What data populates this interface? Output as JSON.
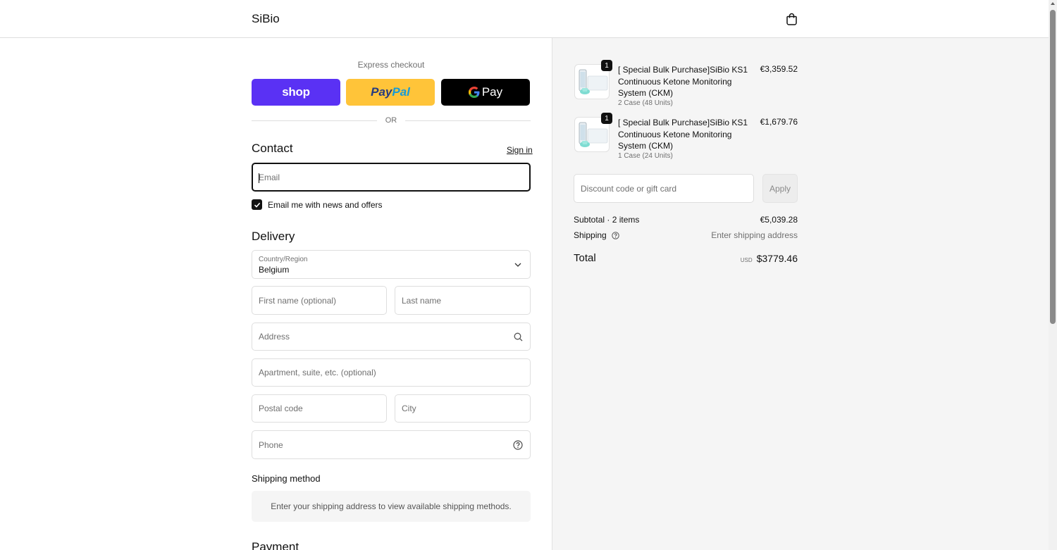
{
  "header": {
    "brand": "SiBio"
  },
  "express": {
    "label": "Express checkout",
    "shop_label": "shop",
    "paypal_label_1": "Pay",
    "paypal_label_2": "Pal",
    "gpay_label": "Pay",
    "or_label": "OR"
  },
  "contact": {
    "title": "Contact",
    "signin_label": "Sign in",
    "email_placeholder": "Email",
    "newsletter_label": "Email me with news and offers",
    "newsletter_checked": true
  },
  "delivery": {
    "title": "Delivery",
    "country_label": "Country/Region",
    "country_value": "Belgium",
    "first_name_placeholder": "First name (optional)",
    "last_name_placeholder": "Last name",
    "address_placeholder": "Address",
    "apartment_placeholder": "Apartment, suite, etc. (optional)",
    "postal_placeholder": "Postal code",
    "city_placeholder": "City",
    "phone_placeholder": "Phone"
  },
  "shipping_method": {
    "title": "Shipping method",
    "message": "Enter your shipping address to view available shipping methods."
  },
  "payment": {
    "title": "Payment"
  },
  "order": {
    "items": [
      {
        "quantity": "1",
        "name": "[ Special Bulk Purchase]SiBio KS1 Continuous Ketone Monitoring System (CKM)",
        "variant": "2 Case (48 Units)",
        "price": "€3,359.52"
      },
      {
        "quantity": "1",
        "name": "[ Special Bulk Purchase]SiBio KS1 Continuous Ketone Monitoring System (CKM)",
        "variant": "1 Case (24 Units)",
        "price": "€1,679.76"
      }
    ],
    "discount_placeholder": "Discount code or gift card",
    "apply_label": "Apply",
    "subtotal_label": "Subtotal · 2 items",
    "subtotal_value": "€5,039.28",
    "shipping_label": "Shipping",
    "shipping_value": "Enter shipping address",
    "total_label": "Total",
    "total_currency": "USD",
    "total_value": "$3779.46"
  },
  "colors": {
    "shop_purple": "#5a31f4",
    "paypal_yellow": "#ffc439",
    "gpay_black": "#000000"
  }
}
